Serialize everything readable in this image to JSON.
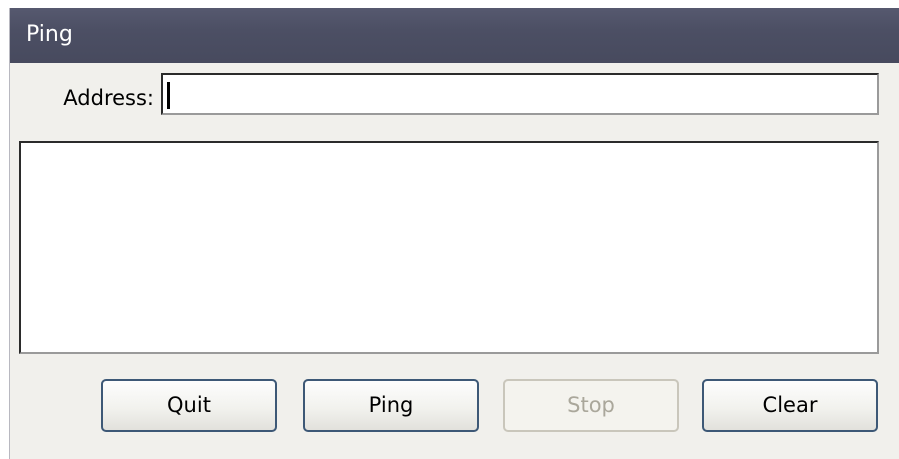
{
  "window": {
    "title": "Ping"
  },
  "address": {
    "label": "Address:",
    "value": "",
    "placeholder": ""
  },
  "output": {
    "text": ""
  },
  "buttons": {
    "quit": "Quit",
    "ping": "Ping",
    "stop": "Stop",
    "clear": "Clear"
  },
  "states": {
    "stop_disabled": true
  },
  "colors": {
    "titlebar": "#4c4f64",
    "window_bg": "#f1f0ec",
    "button_border": "#3d5876",
    "disabled_text": "#aaa79b"
  }
}
